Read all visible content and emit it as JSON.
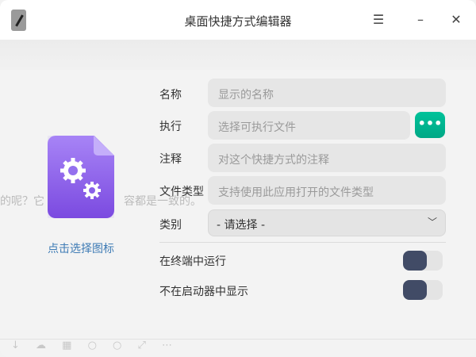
{
  "window": {
    "title": "桌面快捷方式编辑器"
  },
  "background": {
    "text_left": "的呢？它",
    "text_right": "容都是一致的。",
    "toolbar_icons": "↓ ☁ ▦ ○ ○ ⤢ ⋯"
  },
  "icon_panel": {
    "pick_label": "点击选择图标"
  },
  "form": {
    "name": {
      "label": "名称",
      "placeholder": "显示的名称",
      "value": ""
    },
    "exec": {
      "label": "执行",
      "placeholder": "选择可执行文件",
      "value": "",
      "browse_label": "•••"
    },
    "comment": {
      "label": "注释",
      "placeholder": "对这个快捷方式的注释",
      "value": ""
    },
    "mimetype": {
      "label": "文件类型",
      "placeholder": "支持使用此应用打开的文件类型",
      "value": ""
    },
    "category": {
      "label": "类别",
      "selected": "- 请选择 -"
    },
    "terminal": {
      "label": "在终端中运行",
      "checked": false
    },
    "nodisplay": {
      "label": "不在启动器中显示",
      "checked": false
    }
  },
  "colors": {
    "accent": "#00b08f",
    "link": "#3e7bb5",
    "toggle_knob": "#414b66"
  }
}
